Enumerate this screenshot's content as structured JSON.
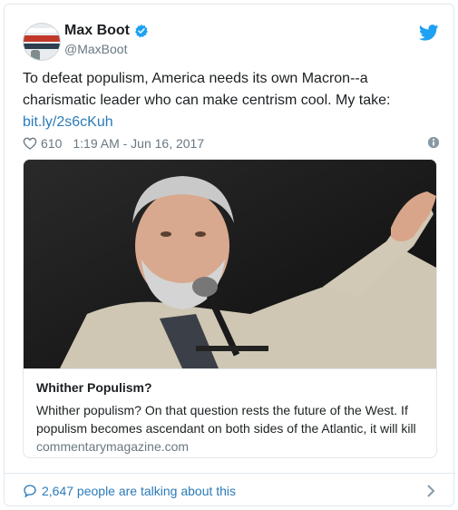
{
  "tweet": {
    "author_name": "Max Boot",
    "author_handle": "@MaxBoot",
    "avatar_text": [
      "CORROSION",
      "CONSERVATISM"
    ],
    "text_main": "To defeat populism, America needs its own Macron--a charismatic leader who can make centrism cool. My take: ",
    "link_text": "bit.ly/2s6cKuh",
    "likes": "610",
    "timestamp": "1:19 AM - Jun 16, 2017"
  },
  "card": {
    "title": "Whither Populism?",
    "description": "Whither populism? On that question rests the future of the West. If populism becomes ascendant on both sides of the Atlantic, it will kill",
    "domain": "commentarymagazine.com"
  },
  "footer": {
    "talking": "2,647 people are talking about this"
  },
  "colors": {
    "link": "#2b7bb9",
    "muted": "#697882",
    "border": "#e1e8ed",
    "verified": "#1da1f2"
  },
  "icons": [
    "verified-icon",
    "twitter-bird-icon",
    "heart-icon",
    "info-icon",
    "speech-bubble-icon",
    "chevron-right-icon"
  ]
}
